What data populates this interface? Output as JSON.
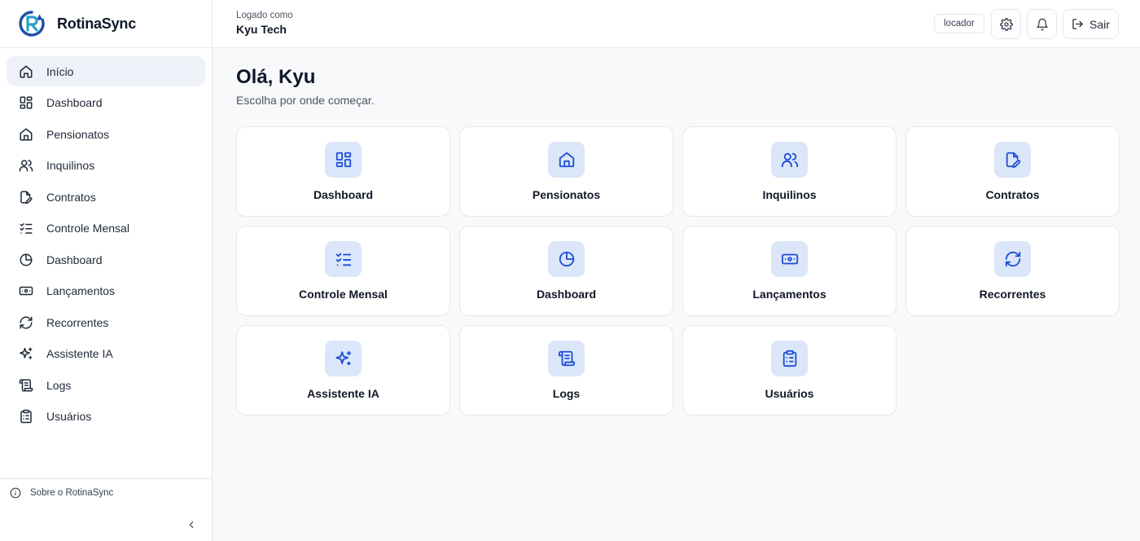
{
  "brand": {
    "name": "RotinaSync"
  },
  "header": {
    "logged_as_label": "Logado como",
    "user_name": "Kyu Tech",
    "role": "locador",
    "logout_label": "Sair"
  },
  "sidebar": {
    "items": [
      {
        "label": "Início",
        "icon": "home-icon"
      },
      {
        "label": "Dashboard",
        "icon": "grid-icon"
      },
      {
        "label": "Pensionatos",
        "icon": "house-icon"
      },
      {
        "label": "Inquilinos",
        "icon": "users-icon"
      },
      {
        "label": "Contratos",
        "icon": "file-edit-icon"
      },
      {
        "label": "Controle Mensal",
        "icon": "checklist-icon"
      },
      {
        "label": "Dashboard",
        "icon": "pie-chart-icon"
      },
      {
        "label": "Lançamentos",
        "icon": "banknote-icon"
      },
      {
        "label": "Recorrentes",
        "icon": "refresh-icon"
      },
      {
        "label": "Assistente IA",
        "icon": "sparkles-icon"
      },
      {
        "label": "Logs",
        "icon": "scroll-icon"
      },
      {
        "label": "Usuários",
        "icon": "clipboard-icon"
      }
    ],
    "footer_about": "Sobre o RotinaSync"
  },
  "main": {
    "greeting": "Olá, Kyu",
    "subtitle": "Escolha por onde começar.",
    "cards": [
      {
        "label": "Dashboard",
        "icon": "grid-icon"
      },
      {
        "label": "Pensionatos",
        "icon": "house-icon"
      },
      {
        "label": "Inquilinos",
        "icon": "users-icon"
      },
      {
        "label": "Contratos",
        "icon": "file-edit-icon"
      },
      {
        "label": "Controle Mensal",
        "icon": "checklist-icon"
      },
      {
        "label": "Dashboard",
        "icon": "pie-chart-icon"
      },
      {
        "label": "Lançamentos",
        "icon": "banknote-icon"
      },
      {
        "label": "Recorrentes",
        "icon": "refresh-icon"
      },
      {
        "label": "Assistente IA",
        "icon": "sparkles-icon"
      },
      {
        "label": "Logs",
        "icon": "scroll-icon"
      },
      {
        "label": "Usuários",
        "icon": "clipboard-icon"
      }
    ]
  },
  "colors": {
    "accent": "#1d4ed8",
    "accent_bg": "#dbe6f8",
    "active_nav_bg": "#eef2f8",
    "border": "#e5e7eb",
    "page_bg": "#f8f9fb"
  }
}
